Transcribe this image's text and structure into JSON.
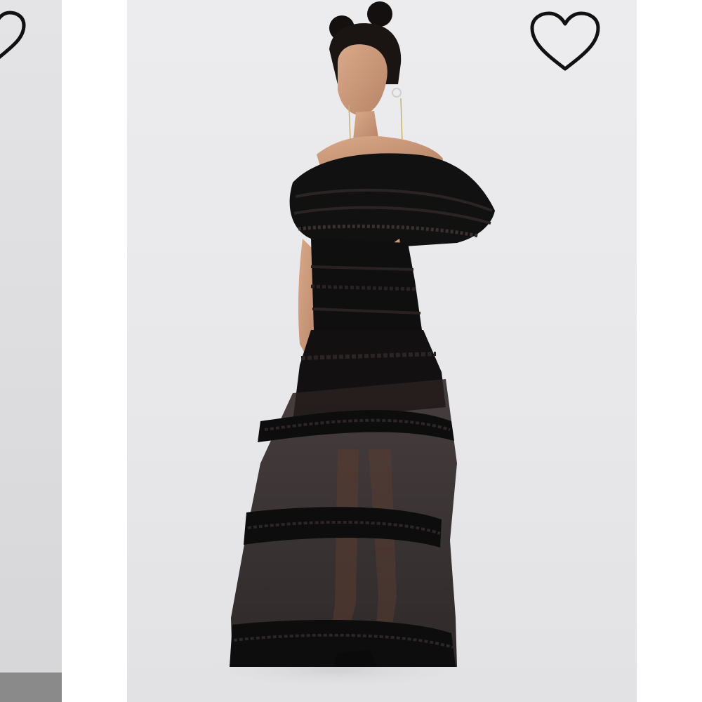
{
  "gallery": {
    "prev_card": {
      "favorite_icon": "heart-outline-icon",
      "background": "#dedee0",
      "bottom_bar_color": "#8a8a8a"
    },
    "main_card": {
      "favorite_icon": "heart-outline-icon",
      "background": "#eaeaec",
      "product_image": "model-in-black-tiered-ruffle-off-shoulder-maxi-dress"
    }
  },
  "colors": {
    "page_background": "#ffffff",
    "icon_stroke": "#111111",
    "dress": "#121212"
  }
}
